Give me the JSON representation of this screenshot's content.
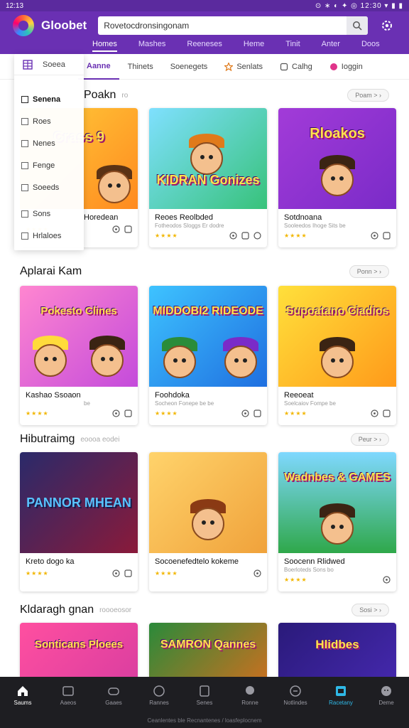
{
  "status_bar": {
    "time": "12:13",
    "right": "⊙ ∗ ◐ ✦ ◎ 12:30 ▾ ▮ ▮"
  },
  "app": {
    "name": "Gloobet"
  },
  "search": {
    "value": "Rovetocdronsingonam",
    "placeholder": "Search"
  },
  "top_tabs": [
    "Homes",
    "Mashes",
    "Reeneses",
    "Heme",
    "Tinit",
    "Anter",
    "Doos"
  ],
  "sub_tabs": [
    {
      "label": "Aanne",
      "icon": "grid-icon"
    },
    {
      "label": "Thinets",
      "icon": "tag-icon"
    },
    {
      "label": "Soenegets",
      "icon": "list-icon"
    },
    {
      "label": "Senlats",
      "icon": "star-icon"
    },
    {
      "label": "Calhg",
      "icon": "bell-icon"
    },
    {
      "label": "Ioggin",
      "icon": "heart-icon"
    }
  ],
  "dropdown": {
    "header_label": "Soeea",
    "items": [
      "Senena",
      "Roes",
      "Nenes",
      "Fenge",
      "Soeeds",
      "Sons",
      "Hrlaloes"
    ]
  },
  "sections": [
    {
      "title": "Poakn",
      "subtitle": "ro",
      "see_all": "Poam > ›",
      "cards": [
        {
          "title": "Horedean",
          "sub": "",
          "art": "Crass 9",
          "art_bg": "#ff8a1f",
          "hair": "#5b3214"
        },
        {
          "title": "Reoes Reolbded",
          "sub": "Fotheodos Sloggs Er dodre",
          "art": "KIDRAN Gonizes",
          "art_bg": "#37c27a",
          "hair": "#e07a1a"
        },
        {
          "title": "Sotdnoana",
          "sub": "Sooleedos Ihoge Sits be",
          "art": "Rloakos",
          "art_bg": "#7a2bc8",
          "hair": "#3b2413"
        }
      ]
    },
    {
      "title": "Aplarai Kam",
      "subtitle": "",
      "see_all": "Ponn > ›",
      "cards": [
        {
          "title": "Kashao Ssoaon",
          "sub": "be",
          "art": "Pokesto Clines",
          "art_bg": "#c44bdb",
          "hair": "#ffdb3b"
        },
        {
          "title": "Foohdoka",
          "sub": "Socheon Fonepe be be",
          "art": "MIDDOBI2 RIDEODE",
          "art_bg": "#1f6fe0",
          "hair": "#2a8c3a"
        },
        {
          "title": "Reeoeat",
          "sub": "Soelcaiov Fompe be",
          "art": "Supoatano Ciadios",
          "art_bg": "#ff9a1a",
          "hair": "#3b2413"
        }
      ]
    },
    {
      "title": "Hibutraimg",
      "subtitle": "eoooa eodei",
      "see_all": "Peur > ›",
      "cards": [
        {
          "title": "Kreto dogo ka",
          "sub": "",
          "art": "PANNOR MHEAN",
          "art_bg": "#6a1a8a",
          "hair": "#222222"
        },
        {
          "title": "Socoenefedtelo kokeme",
          "sub": "",
          "art": "",
          "art_bg": "#f0a23b",
          "hair": "#8a3a14"
        },
        {
          "title": "Soocenn Rlidwed",
          "sub": "Boerloteds Sons bo",
          "art": "Wadnbes & GAMES",
          "art_bg": "#2fa84a",
          "hair": "#3b2413"
        }
      ]
    },
    {
      "title": "Kldaragh gnan",
      "subtitle": "roooeosor",
      "see_all": "Sosi > ›",
      "cards": [
        {
          "title": "",
          "sub": "",
          "art": "Sonticans Ploees",
          "art_bg": "#d23aa0",
          "hair": "#3b2413"
        },
        {
          "title": "",
          "sub": "",
          "art": "SAMRON Qannes",
          "art_bg": "#ee6a1a",
          "hair": "#3b2413"
        },
        {
          "title": "",
          "sub": "",
          "art": "Hlidbes",
          "art_bg": "#4a2bb8",
          "hair": "#3b2413"
        }
      ]
    }
  ],
  "rating_stars": "★★★★",
  "bottom_nav": [
    {
      "label": "Saums",
      "icon": "home-icon"
    },
    {
      "label": "Aaeos",
      "icon": "image-icon"
    },
    {
      "label": "Gaaes",
      "icon": "game-icon"
    },
    {
      "label": "Rannes",
      "icon": "compass-icon"
    },
    {
      "label": "Senes",
      "icon": "bookmark-icon"
    },
    {
      "label": "Ronne",
      "icon": "chat-icon"
    },
    {
      "label": "Notlindes",
      "icon": "notification-icon"
    },
    {
      "label": "Racetany",
      "icon": "calendar-icon"
    },
    {
      "label": "Deme",
      "icon": "profile-icon"
    }
  ],
  "footer_text": "Ceanlentes ble Recnantenes / loasfeplocnem",
  "colors": {
    "primary": "#6a30b3",
    "nav_bg": "#1e1e22",
    "highlight": "#2fb8e6",
    "star": "#f2b600"
  }
}
